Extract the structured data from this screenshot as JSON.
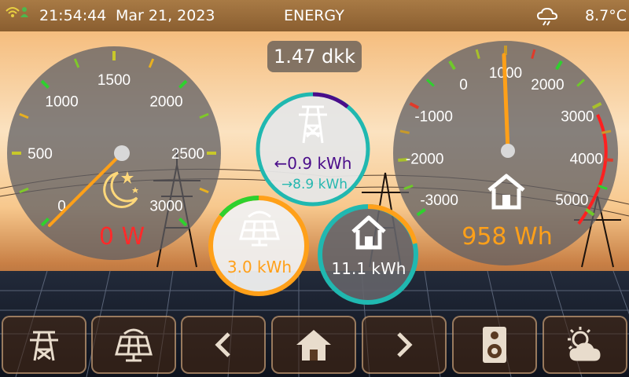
{
  "status_bar": {
    "time": "21:54:44",
    "date": "Mar 21, 2023",
    "title": "ENERGY",
    "temperature": "8.7°C",
    "weather_icon": "cloud-wind-icon",
    "wifi_icon": "wifi-icon",
    "user_icon": "user-icon"
  },
  "price": "1.47 dkk",
  "power_gauge": {
    "ticks": [
      "0",
      "500",
      "1000",
      "1500",
      "2000",
      "2500",
      "3000"
    ],
    "value_label": "0 W",
    "value": 0,
    "range": [
      0,
      3000
    ],
    "icon": "moon-stars-icon",
    "value_color": "#ff2a2a"
  },
  "energy_gauge": {
    "ticks": [
      "-3000",
      "-2000",
      "-1000",
      "0",
      "1000",
      "2000",
      "3000",
      "4000",
      "5000"
    ],
    "value_label": "958 Wh",
    "value": 958,
    "range": [
      -3000,
      5000
    ],
    "icon": "house-icon",
    "value_color": "#ffa019"
  },
  "grid_circle": {
    "import_label": "←0.9 kWh",
    "export_label": "→8.9 kWh",
    "icon": "power-pylon-icon",
    "import_color": "#4a0d8a",
    "export_color": "#26b8b0"
  },
  "solar_circle": {
    "label": "3.0 kWh",
    "icon": "solar-panel-icon",
    "color": "#ffa019"
  },
  "house_circle": {
    "label": "11.1 kWh",
    "icon": "house-icon"
  },
  "nav": [
    {
      "icon": "power-pylon-icon"
    },
    {
      "icon": "solar-panel-icon"
    },
    {
      "icon": "chevron-left-icon"
    },
    {
      "icon": "house-icon"
    },
    {
      "icon": "chevron-right-icon"
    },
    {
      "icon": "speaker-icon"
    },
    {
      "icon": "sun-cloud-icon"
    }
  ]
}
